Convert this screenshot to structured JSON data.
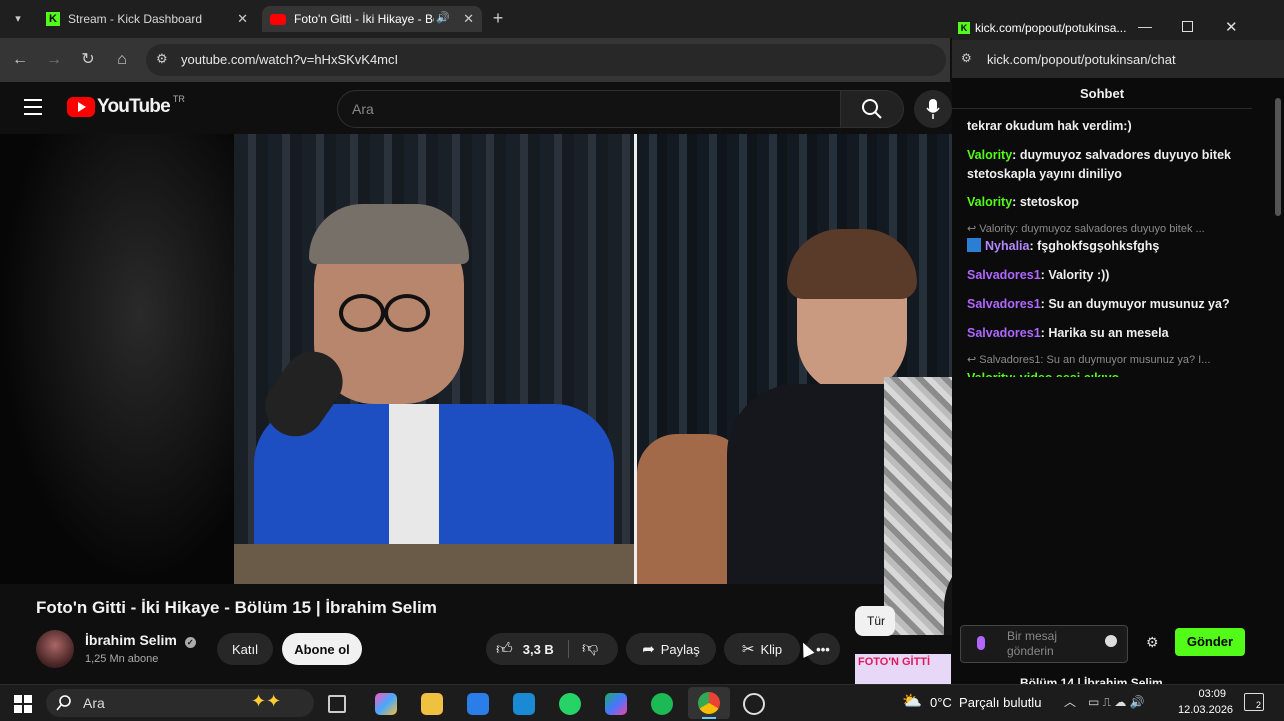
{
  "browser": {
    "tabs": [
      {
        "label": "Stream - Kick Dashboard",
        "active": false
      },
      {
        "label": "Foto'n Gitti - İki Hikaye - Bö",
        "active": true
      }
    ],
    "url": "youtube.com/watch?v=hHxSKvK4mcI"
  },
  "youtube": {
    "logo_text": "YouTube",
    "region": "TR",
    "search_placeholder": "Ara",
    "video_title": "Foto'n Gitti - İki Hikaye - Bölüm 15 | İbrahim Selim",
    "channel_name": "İbrahim Selim",
    "subscribers": "1,25 Mn abone",
    "join_label": "Katıl",
    "subscribe_label": "Abone ol",
    "likes": "3,3 B",
    "share_label": "Paylaş",
    "clip_label": "Klip",
    "side_chip": "Tür",
    "next_video_title": "Bölüm 14 | İbrahim Selim",
    "next_thumb_text": "FOTO'N GİTTİ"
  },
  "popup": {
    "title": "kick.com/popout/potukinsa...",
    "url": "kick.com/popout/potukinsan/chat",
    "chat_title": "Sohbet",
    "input_placeholder": "Bir mesaj gönderin",
    "send_label": "Gönder",
    "messages": [
      {
        "user": "",
        "text": "tekrar okudum hak verdim:)",
        "color": "#ffffff"
      },
      {
        "user": "Valority",
        "text": "duymuyoz salvadores duyuyo bitek stetoskapla yayını diniliyo",
        "color": "#53fc18"
      },
      {
        "user": "Valority",
        "text": "stetoskop",
        "color": "#53fc18"
      },
      {
        "user": "Nyhalia",
        "text": "fşghokfsgşohksfghş",
        "color": "#b388ff"
      },
      {
        "user": "Salvadores1",
        "text": "Valority :))",
        "color": "#b066ff"
      },
      {
        "user": "Salvadores1",
        "text": "Su an duymuyor musunuz ya?",
        "color": "#b066ff"
      },
      {
        "user": "Salvadores1",
        "text": "Harika su an mesela",
        "color": "#b066ff"
      }
    ],
    "replies": [
      "Valority: duymuyoz salvadores duyuyo bitek ...",
      "Salvadores1: Su an duymuyor musunuz ya? I..."
    ],
    "partial_line": "Valority: video sesi çıkıyo"
  },
  "taskbar": {
    "search_label": "Ara",
    "weather": "0°C  Parçalı bulutlu",
    "time": "03:09",
    "date": "12.03.2026",
    "notif_count": "2"
  },
  "colors": {
    "kick_green": "#53fc18",
    "yt_red": "#ff0000",
    "shirt_blue": "#1e4fc2"
  }
}
